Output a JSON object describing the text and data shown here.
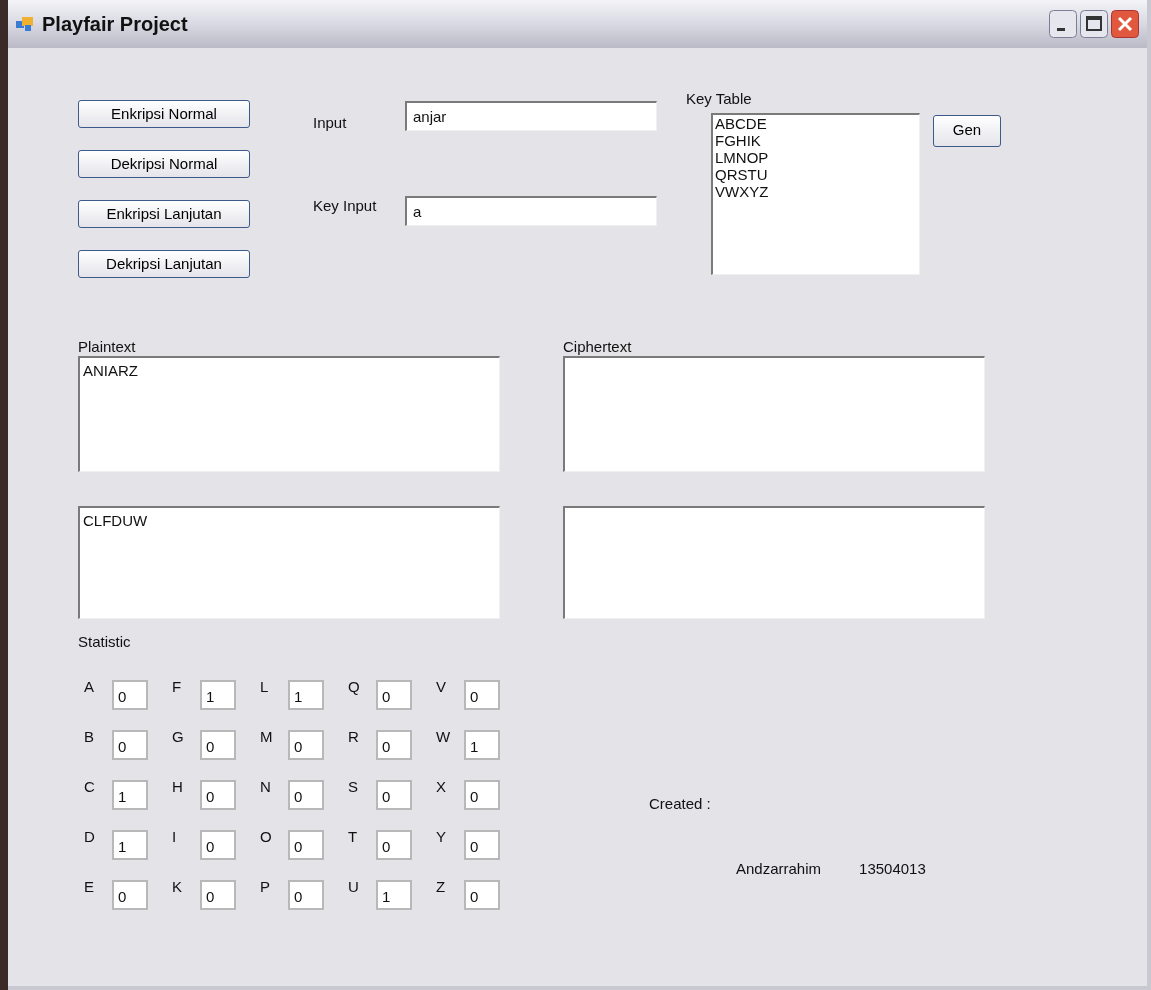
{
  "window": {
    "title": "Playfair Project"
  },
  "actions": [
    "Enkripsi Normal",
    "Dekripsi Normal",
    "Enkripsi Lanjutan",
    "Dekripsi Lanjutan"
  ],
  "input": {
    "label": "Input",
    "value": "anjar"
  },
  "key_input": {
    "label": "Key Input",
    "value": "a"
  },
  "key_table": {
    "label": "Key Table",
    "lines": [
      "ABCDE",
      "FGHIK",
      "LMNOP",
      "QRSTU",
      "VWXYZ"
    ]
  },
  "gen_button": "Gen",
  "plaintext": {
    "label": "Plaintext",
    "value": "ANIARZ"
  },
  "ciphertext": {
    "label": "Ciphertext"
  },
  "result": {
    "value": "CLFDUW"
  },
  "statistic": {
    "label": "Statistic",
    "counts": [
      {
        "letter": "A",
        "count": "0"
      },
      {
        "letter": "B",
        "count": "0"
      },
      {
        "letter": "C",
        "count": "1"
      },
      {
        "letter": "D",
        "count": "1"
      },
      {
        "letter": "E",
        "count": "0"
      },
      {
        "letter": "F",
        "count": "1"
      },
      {
        "letter": "G",
        "count": "0"
      },
      {
        "letter": "H",
        "count": "0"
      },
      {
        "letter": "I",
        "count": "0"
      },
      {
        "letter": "K",
        "count": "0"
      },
      {
        "letter": "L",
        "count": "1"
      },
      {
        "letter": "M",
        "count": "0"
      },
      {
        "letter": "N",
        "count": "0"
      },
      {
        "letter": "O",
        "count": "0"
      },
      {
        "letter": "P",
        "count": "0"
      },
      {
        "letter": "Q",
        "count": "0"
      },
      {
        "letter": "R",
        "count": "0"
      },
      {
        "letter": "S",
        "count": "0"
      },
      {
        "letter": "T",
        "count": "0"
      },
      {
        "letter": "U",
        "count": "1"
      },
      {
        "letter": "V",
        "count": "0"
      },
      {
        "letter": "W",
        "count": "1"
      },
      {
        "letter": "X",
        "count": "0"
      },
      {
        "letter": "Y",
        "count": "0"
      },
      {
        "letter": "Z",
        "count": "0"
      }
    ]
  },
  "credits": {
    "label": "Created :",
    "name": "Andzarrahim",
    "id": "13504013"
  }
}
